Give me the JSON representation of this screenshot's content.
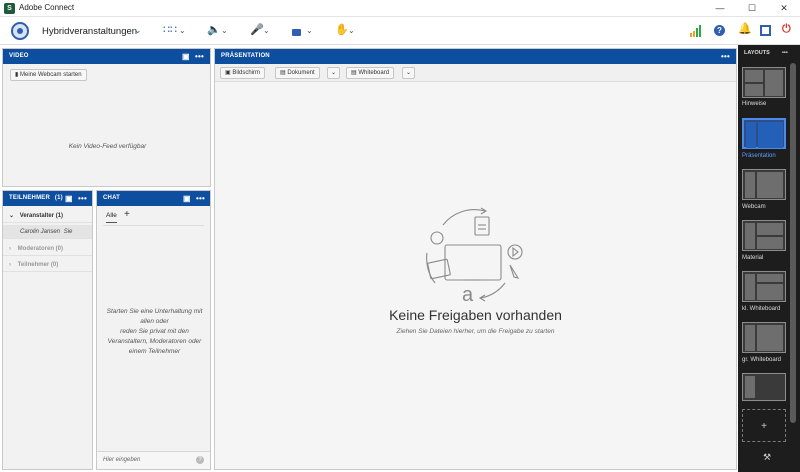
{
  "window": {
    "title": "Adobe Connect",
    "logo_letter": "S"
  },
  "toolbar": {
    "room_name": "Hybridveranstaltungen",
    "caret": "⌄",
    "icons": [
      "apps-grid-icon",
      "speaker-icon",
      "microphone-icon",
      "camera-icon",
      "raise-hand-icon",
      "signal-strength-icon",
      "help-icon",
      "notifications-icon",
      "fullscreen-icon",
      "power-icon"
    ]
  },
  "video": {
    "title": "VIDEO",
    "start_webcam": "Meine Webcam starten",
    "no_feed": "Kein Video-Feed verfügbar"
  },
  "participants": {
    "title": "TEILNEHMER",
    "count": "(1)",
    "groups": [
      {
        "label": "Veranstalter (1)",
        "expanded": true
      },
      {
        "label": "Moderatoren (0)",
        "expanded": false
      },
      {
        "label": "Teilnehmer (0)",
        "expanded": false
      }
    ],
    "member": {
      "name": "Carolin Jansen",
      "suffix": "Sie"
    }
  },
  "chat": {
    "title": "CHAT",
    "tab_all": "Alle",
    "tab_add": "+",
    "empty_line1": "Starten Sie eine Unterhaltung mit",
    "empty_line2": "allen oder",
    "empty_line3": "reden Sie privat mit den",
    "empty_line4": "Veranstaltern, Moderatoren oder",
    "empty_line5": "einem Teilnehmer",
    "input_placeholder": "Hier eingeben"
  },
  "presentation": {
    "title": "PRÄSENTATION",
    "btn_screen": "Bildschirm",
    "btn_document": "Dokument",
    "btn_whiteboard": "Whiteboard",
    "empty_title": "Keine Freigaben vorhanden",
    "empty_subtitle": "Ziehen Sie Dateien hierher, um die Freigabe zu starten"
  },
  "layouts": {
    "title": "LAYOUTS",
    "items": [
      {
        "label": "Hinweise",
        "selected": false
      },
      {
        "label": "Präsentation",
        "selected": true
      },
      {
        "label": "Webcam",
        "selected": false
      },
      {
        "label": "Material",
        "selected": false
      },
      {
        "label": "kl. Whiteboard",
        "selected": false
      },
      {
        "label": "gr. Whiteboard",
        "selected": false
      }
    ],
    "add": "+",
    "colors": {
      "accent": "#0d4e9e",
      "selected": "#4d8ae8",
      "panel_bg": "#1d1d1d"
    }
  },
  "more": "•••"
}
